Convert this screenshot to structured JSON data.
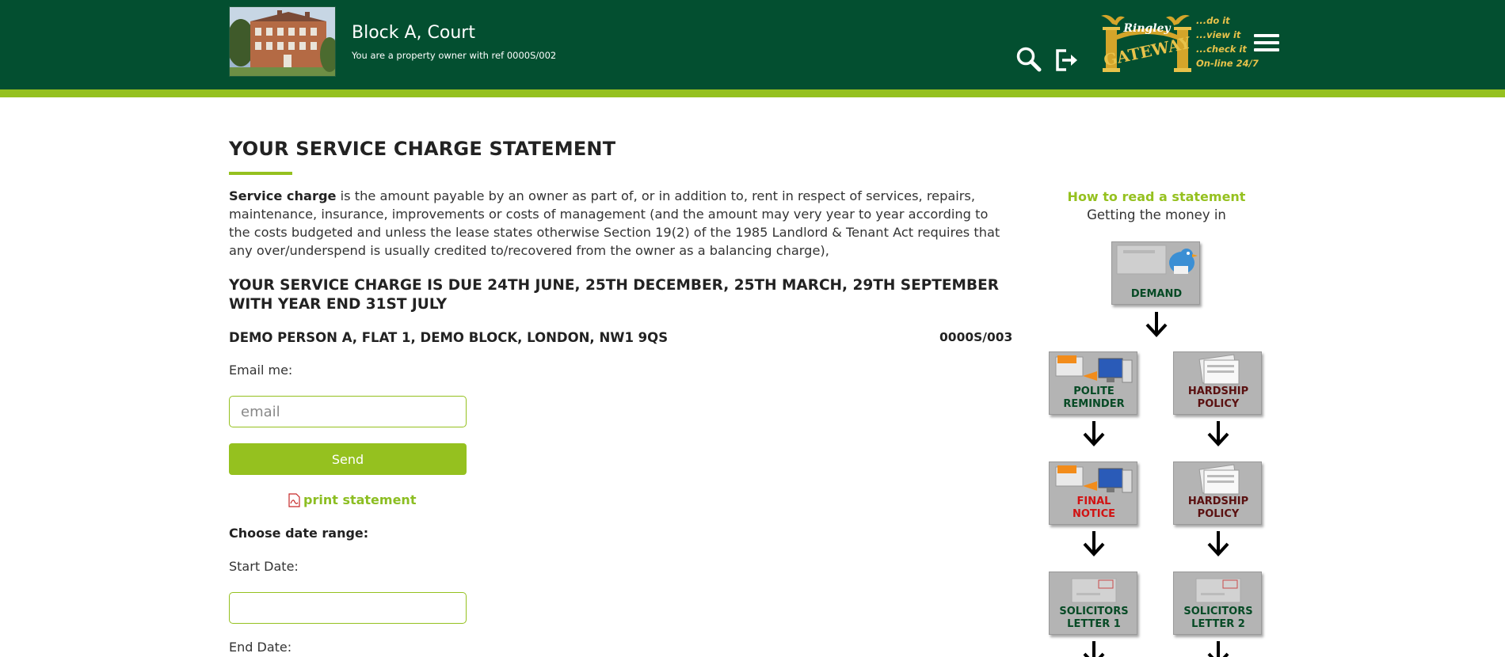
{
  "header": {
    "title": "Block A, Court",
    "subtitle": "You are a property owner with ref 0000S/002",
    "logo": {
      "brand": "Ringley",
      "name": "GATEWAY",
      "taglines": [
        "...do it",
        "...view it",
        "...check it",
        "On-line 24/7"
      ]
    },
    "icons": [
      "search-icon",
      "logout-icon",
      "menu-icon"
    ]
  },
  "main": {
    "title": "YOUR SERVICE CHARGE STATEMENT",
    "intro_bold": "Service charge",
    "intro_rest": " is the amount payable by an owner as part of, or in addition to, rent in respect of services, repairs, maintenance, insurance, improvements or costs of management (and the amount may very year to year according to the costs budgeted and unless the lease states otherwise Section 19(2) of the 1985 Landlord & Tenant Act requires that any over/underspend is usually credited to/recovered from the owner as a balancing charge),",
    "due_heading": "YOUR SERVICE CHARGE IS DUE 24TH JUNE, 25TH DECEMBER, 25TH MARCH, 29TH SEPTEMBER WITH YEAR END 31ST JULY",
    "address": "DEMO PERSON A, FLAT 1, DEMO BLOCK, LONDON, NW1 9QS",
    "ref": "0000S/003",
    "email_label": "Email me:",
    "email_placeholder": "email",
    "send_label": "Send",
    "print_label": "print statement",
    "range_label": "Choose date range:",
    "start_label": "Start Date:",
    "end_label": "End Date:"
  },
  "sidebar": {
    "link": "How to read a statement",
    "subtitle": "Getting the money in",
    "steps": {
      "demand": "DEMAND",
      "polite_reminder": [
        "POLITE",
        "REMINDER"
      ],
      "hardship_1": [
        "HARDSHIP",
        "POLICY"
      ],
      "final_notice": [
        "FINAL",
        "NOTICE"
      ],
      "hardship_2": [
        "HARDSHIP",
        "POLICY"
      ],
      "solicitors_1": [
        "SOLICITORS",
        "LETTER 1"
      ],
      "solicitors_2": [
        "SOLICITORS",
        "LETTER 2"
      ]
    }
  },
  "colors": {
    "header": "#034f30",
    "accent": "#95c11f",
    "final_notice": "#d11212"
  }
}
